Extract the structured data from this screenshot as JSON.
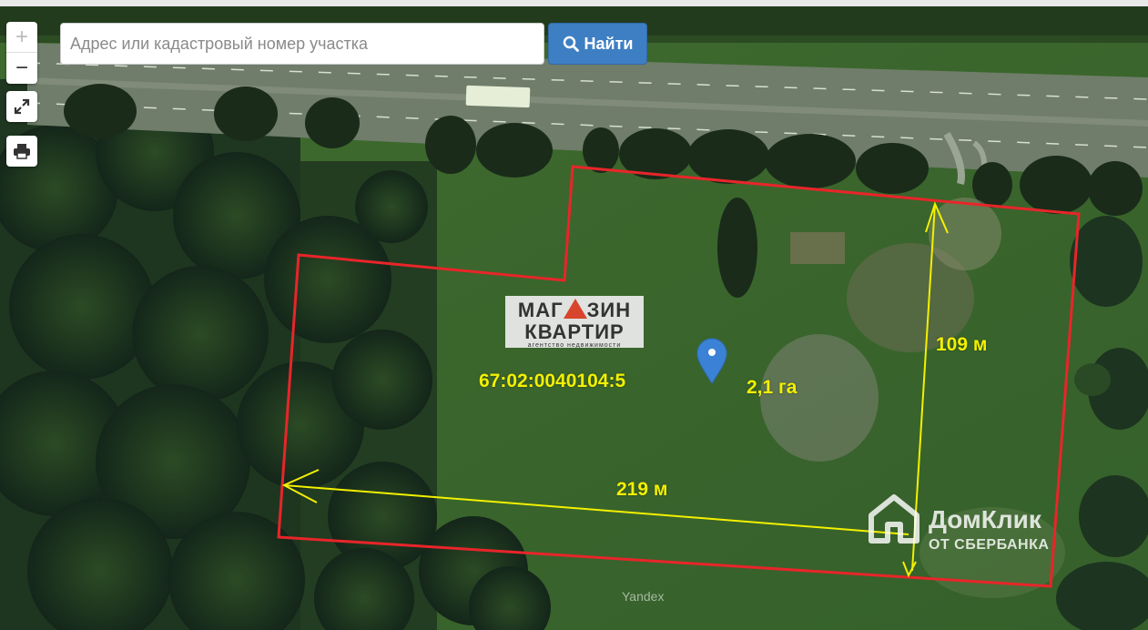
{
  "search": {
    "placeholder": "Адрес или кадастровый номер участка",
    "button_label": "Найти"
  },
  "controls": {
    "zoom_in": "+",
    "zoom_out": "−"
  },
  "plot": {
    "cadastral_number": "67:02:0040104:5",
    "area": "2,1 га",
    "width_label": "219 м",
    "height_label": "109 м"
  },
  "watermarks": {
    "magazin_line1_left": "МАГ",
    "magazin_line1_right": "ЗИН",
    "magazin_line2": "КВАРТИР",
    "magazin_line3": "агентство недвижимости",
    "domclick_line1": "ДомКлик",
    "domclick_line2": "ОТ СБЕРБАНКА",
    "map_provider": "Yandex"
  },
  "colors": {
    "boundary": "#e8252a",
    "dimension": "#f3f000",
    "marker": "#3b82d6",
    "search_button": "#3e7fc3"
  },
  "icons": [
    "plus-icon",
    "minus-icon",
    "fullscreen-icon",
    "print-icon",
    "search-icon",
    "map-marker-icon",
    "house-logo-icon"
  ]
}
